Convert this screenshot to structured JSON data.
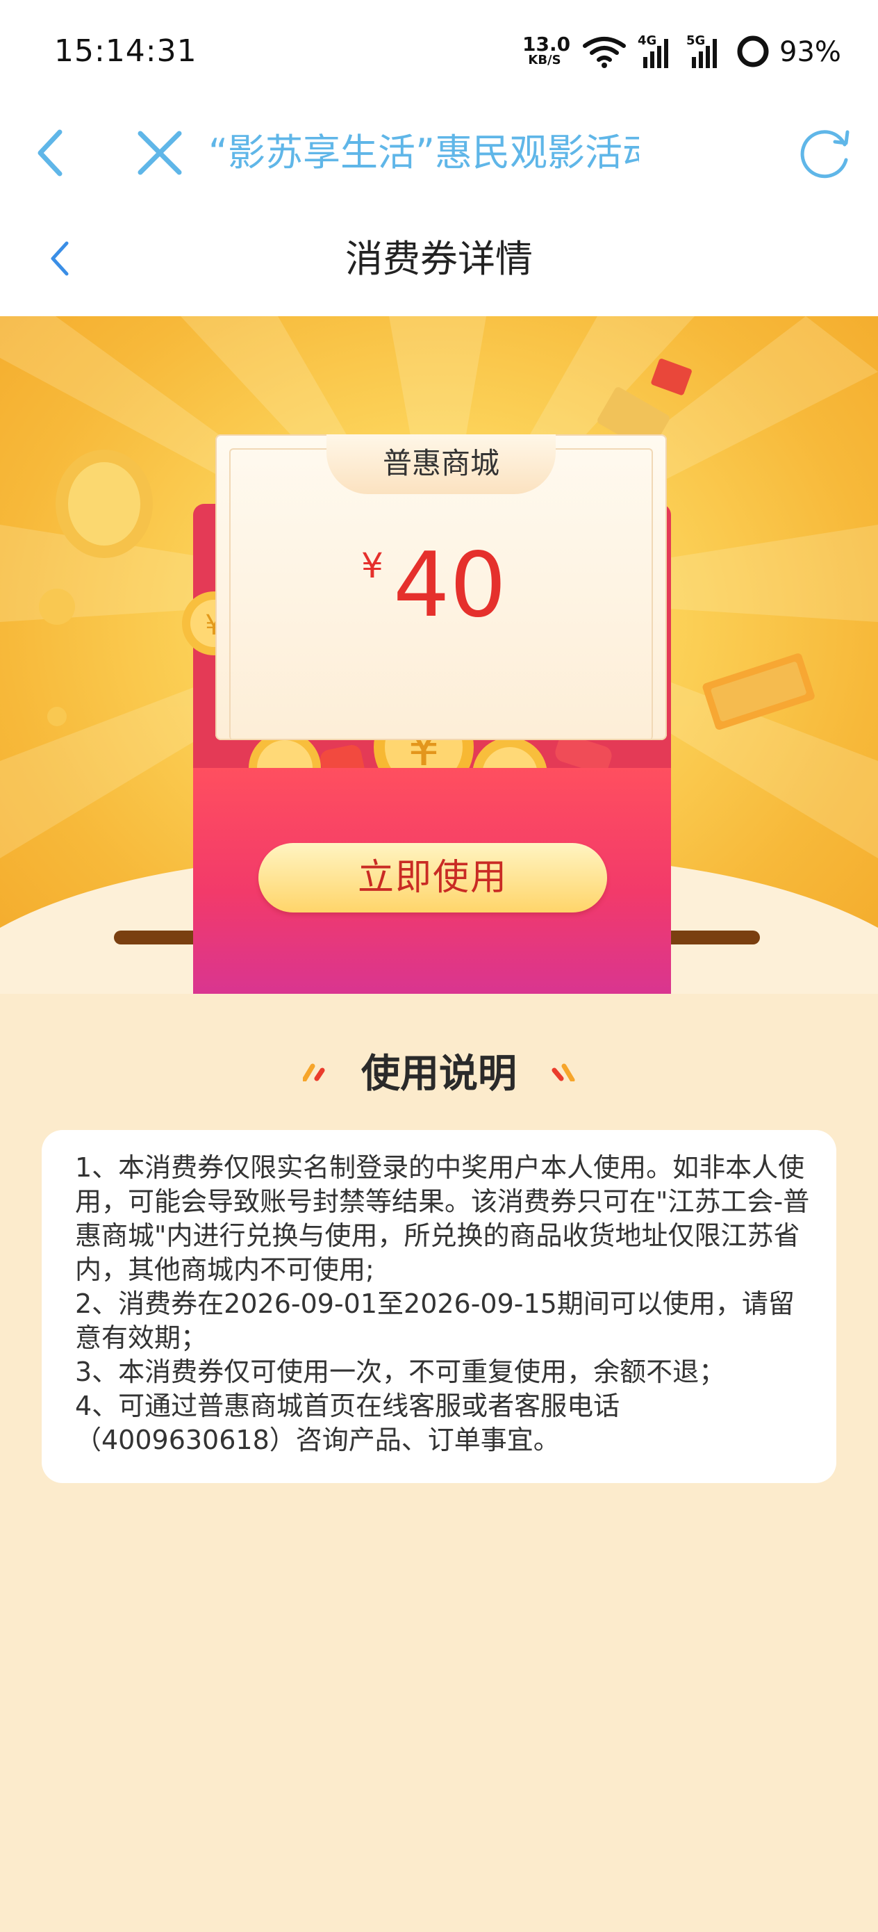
{
  "status_bar": {
    "time": "15:14:31",
    "net_speed": "13.0",
    "net_unit": "KB/S",
    "battery": "93%",
    "icons": [
      "wifi-icon",
      "signal-4g-icon",
      "signal-5g-icon",
      "battery-icon"
    ]
  },
  "browser": {
    "title": "“影苏享生活”惠民观影活动"
  },
  "page": {
    "title": "消费券详情"
  },
  "coupon": {
    "store": "普惠商城",
    "currency": "¥",
    "amount": "40",
    "use_button": "立即使用"
  },
  "instructions": {
    "title": "使用说明",
    "lines": [
      "1、本消费券仅限实名制登录的中奖用户本人使用。如非本人使用，可能会导致账号封禁等结果。该消费券只可在\"江苏工会-普惠商城\"内进行兑换与使用，所兑换的商品收货地址仅限江苏省内，其他商城内不可使用;",
      "2、消费券在2026-09-01至2026-09-15期间可以使用，请留意有效期；",
      "3、本消费券仅可使用一次，不可重复使用，余额不退；",
      "4、可通过普惠商城首页在线客服或者客服电话（4009630618）咨询产品、订单事宜。"
    ]
  },
  "colors": {
    "accent_red": "#e5302c",
    "link_blue": "#5fb6e8",
    "background": "#fcebcc"
  }
}
